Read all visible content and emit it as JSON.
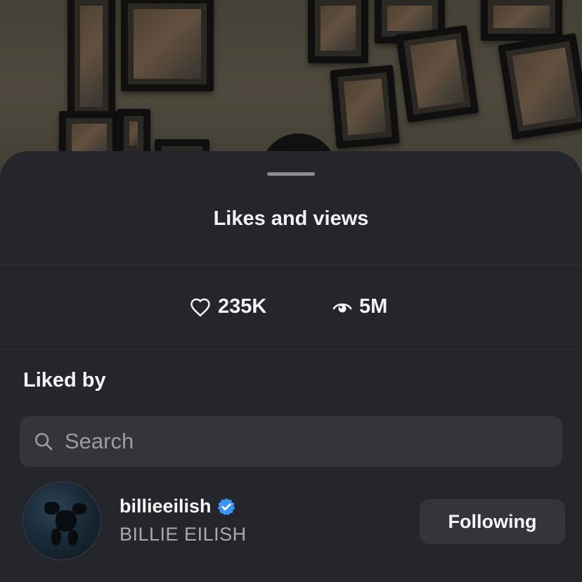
{
  "sheet": {
    "title": "Likes and views"
  },
  "stats": {
    "likes": "235K",
    "views": "5M",
    "likes_icon": "heart-icon",
    "views_icon": "eye-icon"
  },
  "liked_by": {
    "heading": "Liked by",
    "search_placeholder": "Search",
    "search_value": "",
    "users": [
      {
        "username": "billieeilish",
        "display_name": "BILLIE EILISH",
        "verified": true,
        "follow_state": "Following"
      }
    ]
  },
  "colors": {
    "sheet_bg": "#25262b",
    "field_bg": "#33353a",
    "verified_blue": "#3b95f5",
    "text_primary": "#f4f4f5",
    "text_secondary": "#a8aab0"
  }
}
